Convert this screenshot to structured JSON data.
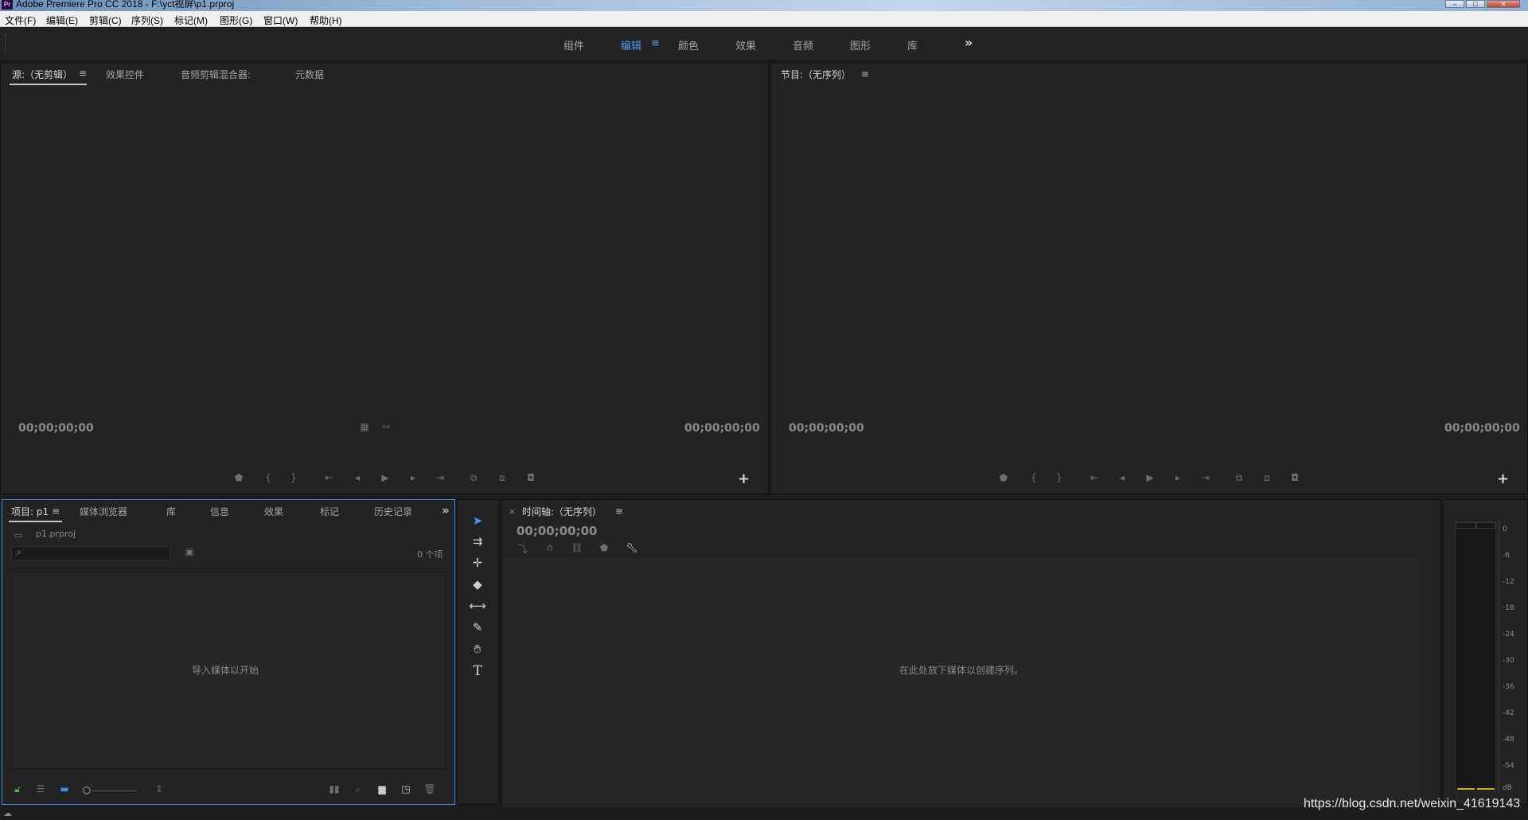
{
  "window": {
    "title": "Adobe Premiere Pro CC 2018 - F:\\yct视屏\\p1.prproj",
    "app_icon": "Pr",
    "minimize": "–",
    "maximize": "□",
    "close": "✕"
  },
  "menu": [
    "文件(F)",
    "编辑(E)",
    "剪辑(C)",
    "序列(S)",
    "标记(M)",
    "图形(G)",
    "窗口(W)",
    "帮助(H)"
  ],
  "workspaces": {
    "items": [
      "组件",
      "编辑",
      "颜色",
      "效果",
      "音频",
      "图形",
      "库"
    ],
    "active": "编辑",
    "menu_glyph": "≡",
    "overflow": "»"
  },
  "source_panel": {
    "tabs": [
      "源:（无剪辑）",
      "效果控件",
      "音频剪辑混合器:",
      "元数据"
    ],
    "menu_glyph": "≡",
    "timecode_left": "00;00;00;00",
    "timecode_right": "00;00;00;00",
    "add_button": "+"
  },
  "program_panel": {
    "tab": "节目:（无序列）",
    "menu_glyph": "≡",
    "timecode_left": "00;00;00;00",
    "timecode_right": "00;00;00;00",
    "add_button": "+"
  },
  "project_panel": {
    "tabs": [
      "项目: p1",
      "媒体浏览器",
      "库",
      "信息",
      "效果",
      "标记",
      "历史记录"
    ],
    "menu_glyph": "≡",
    "overflow": "»",
    "file_name": "p1.prproj",
    "item_count": "0 个项",
    "empty_message": "导入媒体以开始"
  },
  "timeline_panel": {
    "close": "×",
    "tab": "时间轴:（无序列）",
    "menu_glyph": "≡",
    "timecode": "00;00;00;00",
    "empty_message": "在此处放下媒体以创建序列。"
  },
  "audio_meter": {
    "scale": [
      "0",
      "-6",
      "-12",
      "-18",
      "-24",
      "-30",
      "-36",
      "-42",
      "-48",
      "-54",
      "dB"
    ]
  },
  "watermark": "https://blog.csdn.net/weixin_41619143",
  "colors": {
    "accent": "#3f9af2",
    "panel_bg": "#232323",
    "focus_border": "#2d8ceb"
  }
}
